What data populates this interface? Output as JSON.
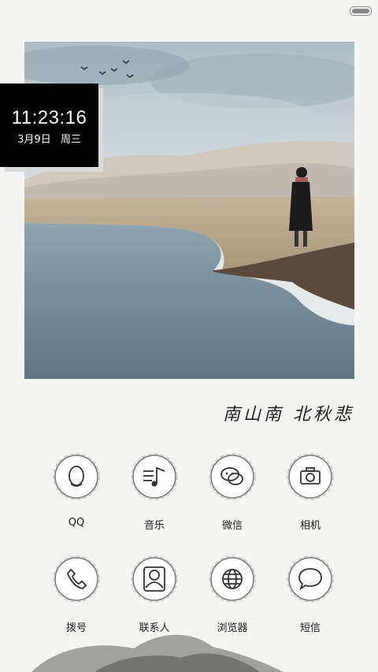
{
  "clock": {
    "time": "11:23:16",
    "date": "3月9日",
    "weekday": "周三"
  },
  "poem": "南山南 北秋悲",
  "apps": [
    {
      "label": "QQ",
      "icon": "qq-penguin-icon"
    },
    {
      "label": "音乐",
      "icon": "music-icon"
    },
    {
      "label": "微信",
      "icon": "wechat-icon"
    },
    {
      "label": "相机",
      "icon": "camera-icon"
    },
    {
      "label": "拨号",
      "icon": "phone-icon"
    },
    {
      "label": "联系人",
      "icon": "contacts-icon"
    },
    {
      "label": "浏览器",
      "icon": "globe-icon"
    },
    {
      "label": "短信",
      "icon": "message-icon"
    }
  ]
}
